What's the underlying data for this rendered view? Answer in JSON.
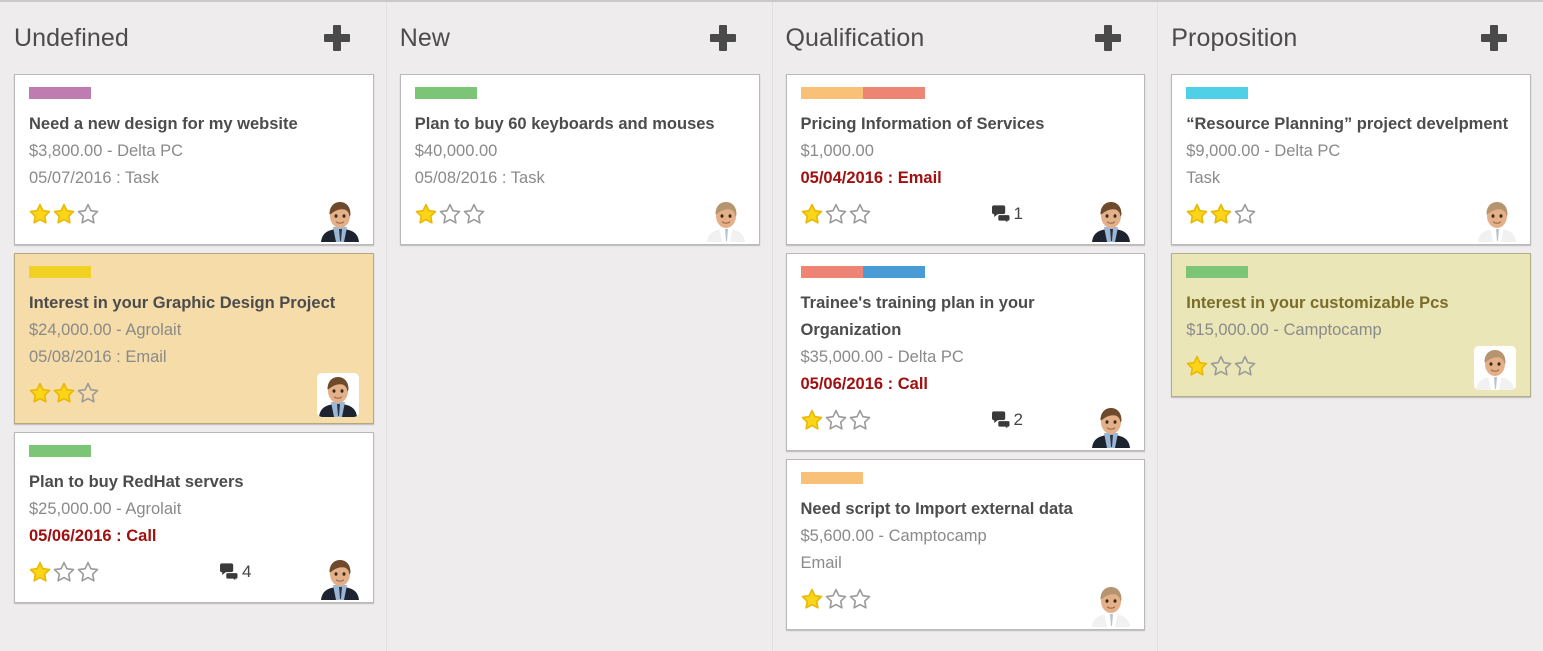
{
  "board": {
    "background": "#eeecec",
    "columns": [
      {
        "name": "Undefined",
        "add_label": "+",
        "cards": [
          {
            "tags": [
              "#bf7cb0"
            ],
            "title": "Need a new design for my website",
            "line1": "$3,800.00 - Delta PC",
            "line2": "05/07/2016 : Task",
            "line2_alert": false,
            "stars_filled": 2,
            "stars_total": 3,
            "comments": null,
            "avatar": "dark-suit-man",
            "bg": "white"
          },
          {
            "tags": [
              "#f2d024"
            ],
            "title": "Interest in your Graphic Design Project",
            "line1": "$24,000.00 - Agrolait",
            "line2": "05/08/2016 : Email",
            "line2_alert": false,
            "stars_filled": 2,
            "stars_total": 3,
            "comments": null,
            "avatar": "dark-suit-man",
            "avatar_boxed": true,
            "bg": "tan"
          },
          {
            "tags": [
              "#7cc576"
            ],
            "title": "Plan to buy RedHat servers",
            "line1": "$25,000.00 - Agrolait",
            "line2": "05/06/2016 : Call",
            "line2_alert": true,
            "stars_filled": 1,
            "stars_total": 3,
            "comments": "4",
            "avatar": "dark-suit-man",
            "bg": "white"
          }
        ]
      },
      {
        "name": "New",
        "add_label": "+",
        "cards": [
          {
            "tags": [
              "#7cc576"
            ],
            "title": "Plan to buy 60 keyboards and mouses",
            "line1": "$40,000.00",
            "line2": "05/08/2016 : Task",
            "line2_alert": false,
            "stars_filled": 1,
            "stars_total": 3,
            "comments": null,
            "avatar": "white-shirt-man",
            "bg": "white"
          }
        ]
      },
      {
        "name": "Qualification",
        "add_label": "+",
        "cards": [
          {
            "tags": [
              "#f9c177",
              "#ee8473"
            ],
            "title": "Pricing Information of Services",
            "line1": "$1,000.00",
            "line2": "05/04/2016 : Email",
            "line2_alert": true,
            "stars_filled": 1,
            "stars_total": 3,
            "comments": "1",
            "avatar": "dark-suit-man",
            "bg": "white"
          },
          {
            "tags": [
              "#ee8473",
              "#4a9bd5"
            ],
            "title": "Trainee's training plan in your Organization",
            "line1": "$35,000.00 - Delta PC",
            "line2": "05/06/2016 : Call",
            "line2_alert": true,
            "stars_filled": 1,
            "stars_total": 3,
            "comments": "2",
            "avatar": "dark-suit-man",
            "bg": "white"
          },
          {
            "tags": [
              "#f9c177"
            ],
            "title": "Need script to Import external data",
            "line1": "$5,600.00 - Camptocamp",
            "line2": "Email",
            "line2_alert": false,
            "stars_filled": 1,
            "stars_total": 3,
            "comments": null,
            "avatar": "white-shirt-man",
            "bg": "white"
          }
        ]
      },
      {
        "name": "Proposition",
        "add_label": "+",
        "cards": [
          {
            "tags": [
              "#4fd0e7"
            ],
            "title": "“Resource Planning” project develpment",
            "line1": "$9,000.00 - Delta PC",
            "line2": "Task",
            "line2_alert": false,
            "stars_filled": 2,
            "stars_total": 3,
            "comments": null,
            "avatar": "white-shirt-man",
            "bg": "white"
          },
          {
            "tags": [
              "#7cc576"
            ],
            "title": "Interest in your customizable Pcs",
            "line1": "$15,000.00 - Camptocamp",
            "line2": null,
            "line2_alert": false,
            "stars_filled": 1,
            "stars_total": 3,
            "comments": null,
            "avatar": "white-shirt-man",
            "avatar_boxed": true,
            "bg": "beige"
          }
        ]
      }
    ]
  },
  "colors": {
    "star_filled": "#fcd518",
    "star_empty_stroke": "#9b9b9b",
    "alert_text": "#a01010",
    "muted_text": "#8a8a8a",
    "title_text": "#4c4c4c",
    "card_white": "#ffffff",
    "card_tan": "#f5dca8",
    "card_beige": "#ebe6b8"
  },
  "icons": {
    "add": "plus-icon",
    "comment": "comment-bubble-icon",
    "star_full": "star-filled-icon",
    "star_empty": "star-empty-icon",
    "avatar": "avatar-photo"
  }
}
